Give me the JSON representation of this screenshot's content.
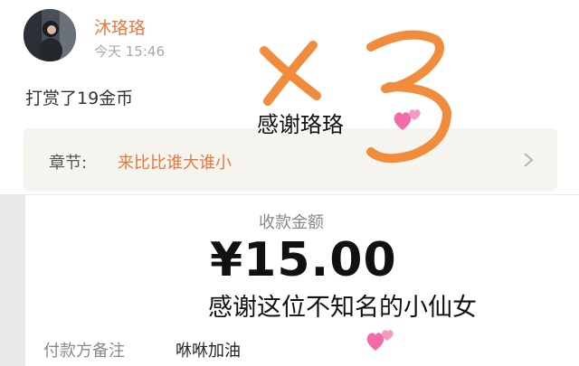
{
  "post": {
    "username": "沐珞珞",
    "time": "今天 15:46",
    "reward_text": "打赏了19金币",
    "avatar_icon": "avatar-photo-icon"
  },
  "chapter": {
    "label": "章节:",
    "title": "来比比谁大谁小",
    "chevron_icon": "chevron-right-icon"
  },
  "payment": {
    "label": "收款金额",
    "amount": "¥15.00",
    "remark_label": "付款方备注",
    "remark_value": "咻咻加油"
  },
  "annotations": {
    "multiplier": "×3",
    "caption_1": "感谢珞珞",
    "caption_2": "感谢这位不知名的小仙女",
    "sticker_icon": "two-hearts-icon"
  },
  "colors": {
    "accent": "#e8763f",
    "scribble": "#f08c3c",
    "heart": "#f06ba8",
    "divider": "#e9e9e9",
    "card": "#f6f4ef"
  }
}
